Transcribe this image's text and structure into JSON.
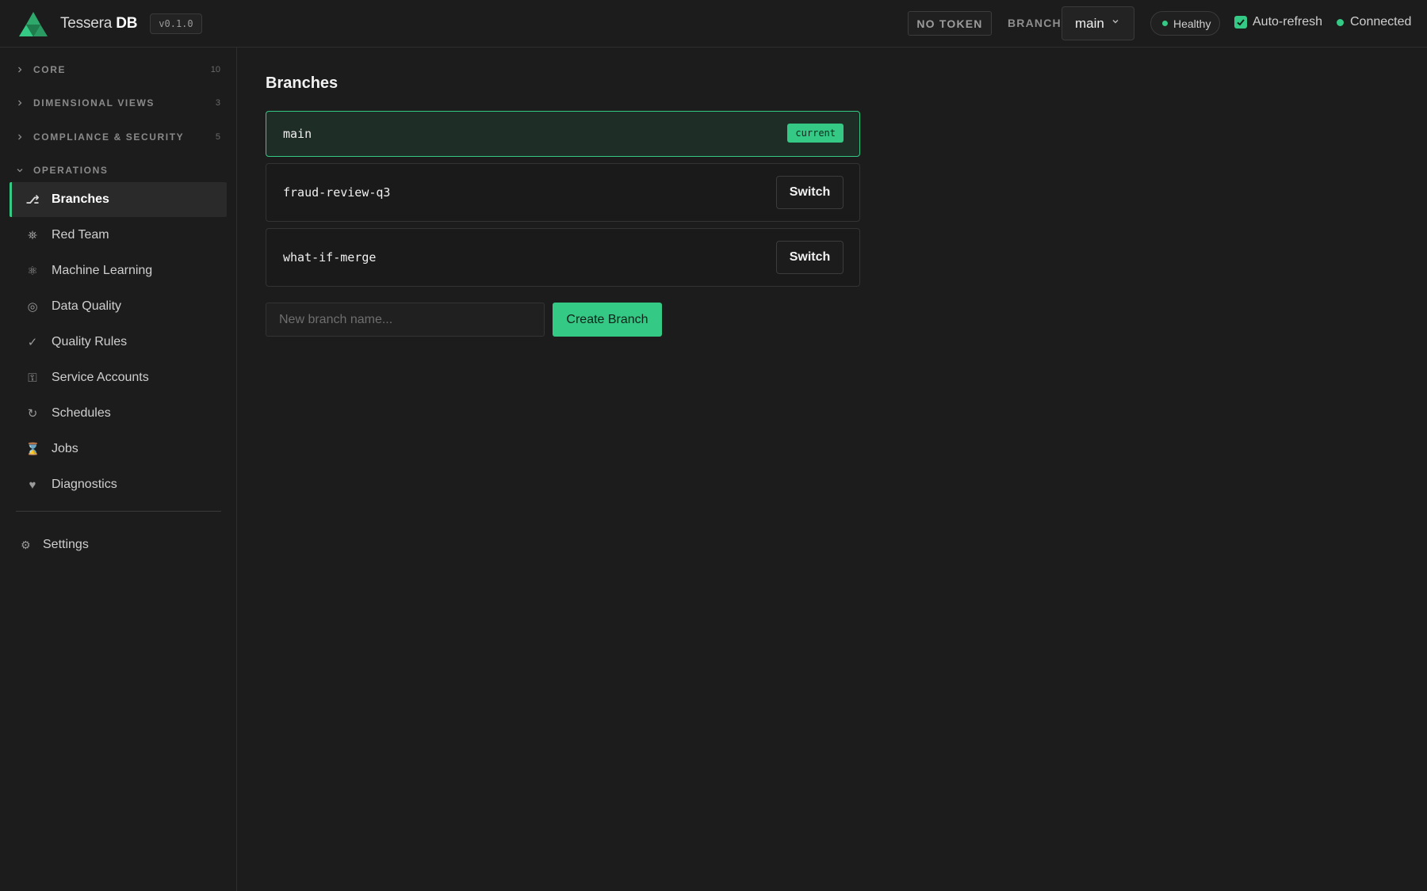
{
  "app": {
    "name_light": "Tessera",
    "name_bold": "DB",
    "version": "v0.1.0"
  },
  "header": {
    "token_label": "NO TOKEN",
    "branch_label": "BRANCH",
    "branch_selected": "main",
    "health_status": "Healthy",
    "auto_refresh_label": "Auto-refresh",
    "auto_refresh_checked": true,
    "connection_status": "Connected",
    "status_color": "#34c984"
  },
  "sidebar": {
    "sections": [
      {
        "label": "CORE",
        "count": "10",
        "expanded": false
      },
      {
        "label": "DIMENSIONAL VIEWS",
        "count": "3",
        "expanded": false
      },
      {
        "label": "COMPLIANCE & SECURITY",
        "count": "5",
        "expanded": false
      },
      {
        "label": "OPERATIONS",
        "count": "",
        "expanded": true
      }
    ],
    "items": [
      {
        "label": "Branches",
        "icon": "branch-icon",
        "glyph": "⎇",
        "active": true
      },
      {
        "label": "Red Team",
        "icon": "red-team-icon",
        "glyph": "⛯",
        "active": false
      },
      {
        "label": "Machine Learning",
        "icon": "atom-icon",
        "glyph": "⚛",
        "active": false
      },
      {
        "label": "Data Quality",
        "icon": "target-icon",
        "glyph": "◎",
        "active": false
      },
      {
        "label": "Quality Rules",
        "icon": "check-icon",
        "glyph": "✓",
        "active": false
      },
      {
        "label": "Service Accounts",
        "icon": "key-icon",
        "glyph": "⚿",
        "active": false
      },
      {
        "label": "Schedules",
        "icon": "refresh-icon",
        "glyph": "↻",
        "active": false
      },
      {
        "label": "Jobs",
        "icon": "hourglass-icon",
        "glyph": "⌛",
        "active": false
      },
      {
        "label": "Diagnostics",
        "icon": "heart-icon",
        "glyph": "♥",
        "active": false
      }
    ],
    "settings": {
      "label": "Settings",
      "icon": "gear-icon",
      "glyph": "⚙"
    }
  },
  "main": {
    "title": "Branches",
    "branches": [
      {
        "name": "main",
        "current": true,
        "badge": "current"
      },
      {
        "name": "fraud-review-q3",
        "current": false,
        "action": "Switch"
      },
      {
        "name": "what-if-merge",
        "current": false,
        "action": "Switch"
      }
    ],
    "new_branch_placeholder": "New branch name...",
    "new_branch_value": "",
    "create_label": "Create Branch"
  }
}
